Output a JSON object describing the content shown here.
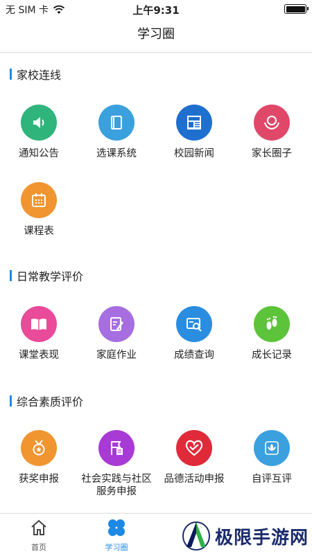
{
  "status_bar": {
    "carrier": "无 SIM 卡",
    "time": "上午9:31",
    "battery_level": 1.0
  },
  "nav": {
    "title": "学习圈"
  },
  "sections": [
    {
      "title": "家校连线",
      "items": [
        {
          "label": "通知公告",
          "icon": "speaker-icon",
          "color": "#2fb47c"
        },
        {
          "label": "选课系统",
          "icon": "book-icon",
          "color": "#3aa0de"
        },
        {
          "label": "校园新闻",
          "icon": "newspaper-icon",
          "color": "#1f6fcf"
        },
        {
          "label": "家长圈子",
          "icon": "parent-child-icon",
          "color": "#e0486a"
        },
        {
          "label": "课程表",
          "icon": "calendar-icon",
          "color": "#f09530"
        }
      ]
    },
    {
      "title": "日常教学评价",
      "items": [
        {
          "label": "课堂表现",
          "icon": "open-book-icon",
          "color": "#e94a9a"
        },
        {
          "label": "家庭作业",
          "icon": "edit-note-icon",
          "color": "#a66ee0"
        },
        {
          "label": "成绩查询",
          "icon": "search-score-icon",
          "color": "#2a8de0"
        },
        {
          "label": "成长记录",
          "icon": "footprint-icon",
          "color": "#5cc33a"
        }
      ]
    },
    {
      "title": "综合素质评价",
      "items": [
        {
          "label": "获奖申报",
          "icon": "medal-icon",
          "color": "#f09530"
        },
        {
          "label": "社会实践与社区服务申报",
          "icon": "flag-document-icon",
          "color": "#a83ad6"
        },
        {
          "label": "品德活动申报",
          "icon": "heart-icon",
          "color": "#e02a3a"
        },
        {
          "label": "自评互评",
          "icon": "lotus-icon",
          "color": "#3aa0de"
        }
      ]
    }
  ],
  "tab_bar": {
    "tabs": [
      {
        "label": "首页",
        "icon": "home-icon",
        "active": false
      },
      {
        "label": "学习圈",
        "icon": "clover-icon",
        "active": true
      }
    ]
  },
  "watermark": {
    "text": "极限手游网"
  },
  "colors": {
    "accent": "#1e88e5"
  }
}
